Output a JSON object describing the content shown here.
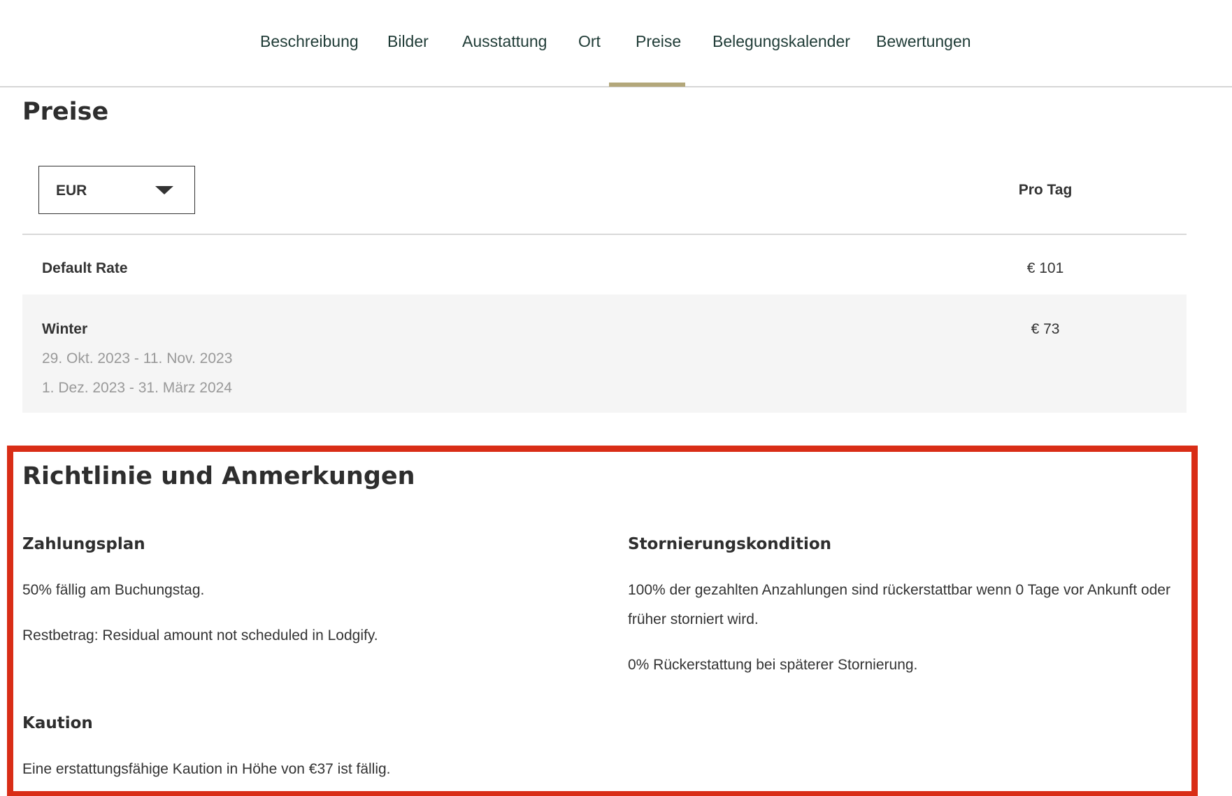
{
  "nav": {
    "items": [
      {
        "label": "Beschreibung"
      },
      {
        "label": "Bilder"
      },
      {
        "label": "Ausstattung"
      },
      {
        "label": "Ort"
      },
      {
        "label": "Preise"
      },
      {
        "label": "Belegungskalender"
      },
      {
        "label": "Bewertungen"
      }
    ],
    "active": "Preise"
  },
  "prices": {
    "title": "Preise",
    "currency": "EUR",
    "column_header": "Pro Tag",
    "rows": [
      {
        "name": "Default Rate",
        "value": "€ 101",
        "dates": []
      },
      {
        "name": "Winter",
        "value": "€ 73",
        "dates": [
          "29. Okt. 2023 - 11. Nov. 2023",
          "1. Dez. 2023 - 31. März 2024"
        ]
      }
    ]
  },
  "policy": {
    "title": "Richtlinie und Anmerkungen",
    "payment": {
      "heading": "Zahlungsplan",
      "lines": [
        "50% fällig am Buchungstag.",
        "Restbetrag: Residual amount not scheduled in Lodgify."
      ]
    },
    "cancellation": {
      "heading": "Stornierungskondition",
      "lines": [
        "100% der gezahlten Anzahlungen sind rückerstattbar wenn 0 Tage vor Ankunft oder früher storniert wird.",
        "0% Rückerstattung bei späterer Stornierung."
      ]
    },
    "deposit": {
      "heading": "Kaution",
      "lines": [
        "Eine erstattungsfähige Kaution in Höhe von €37 ist fällig."
      ]
    }
  },
  "colors": {
    "accent_underline": "#b3a77a",
    "highlight_border": "#d92d16",
    "nav_text": "#1f3b36"
  },
  "icons": {
    "currency_dropdown": "chevron-down-icon"
  }
}
